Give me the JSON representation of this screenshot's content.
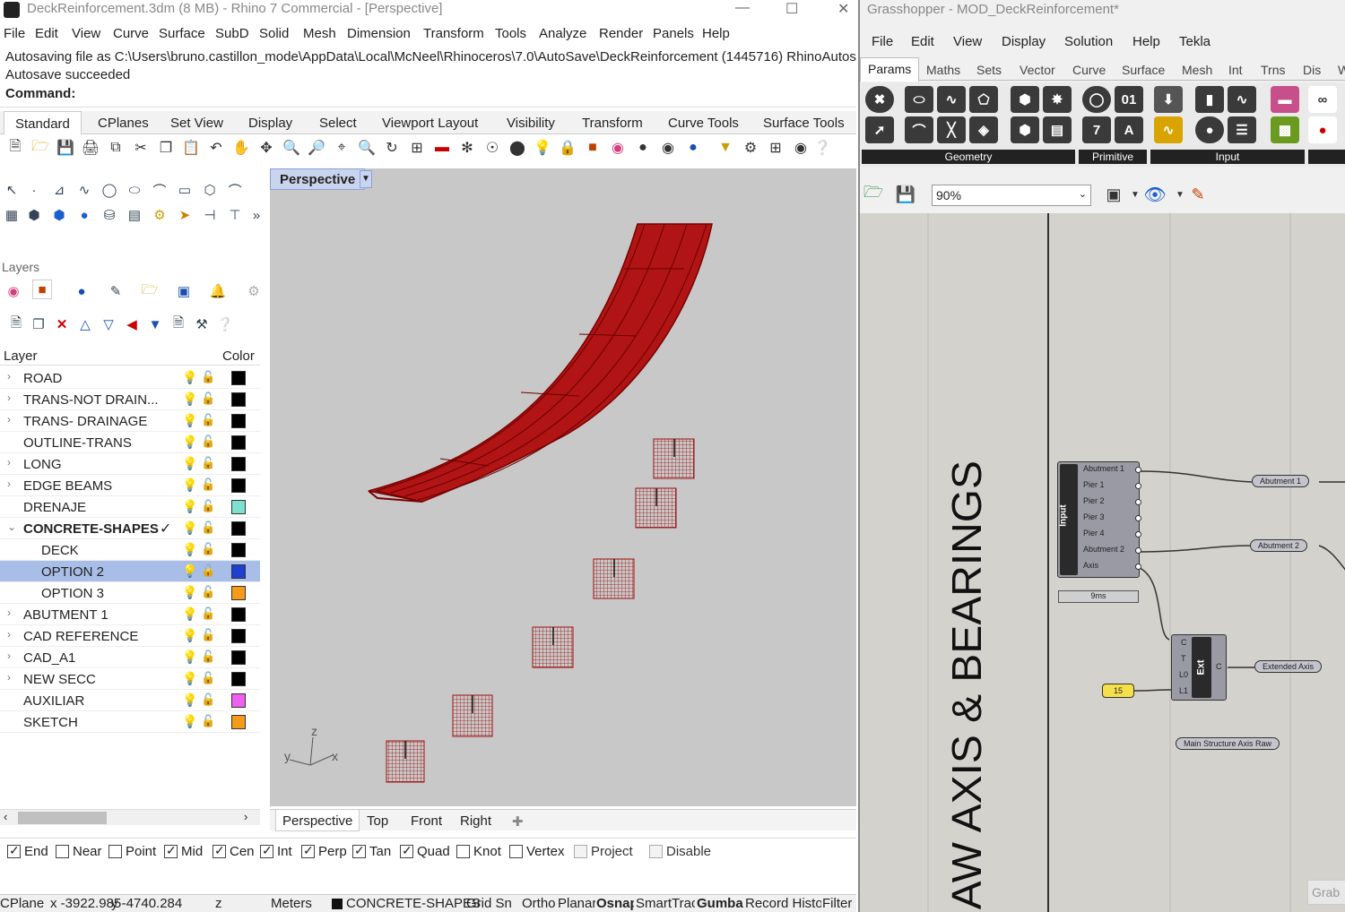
{
  "rhino": {
    "title": "DeckReinforcement.3dm (8 MB) - Rhino 7 Commercial - [Perspective]",
    "menu": [
      "File",
      "Edit",
      "View",
      "Curve",
      "Surface",
      "SubD",
      "Solid",
      "Mesh",
      "Dimension",
      "Transform",
      "Tools",
      "Analyze",
      "Render",
      "Panels",
      "Help"
    ],
    "cmd_history": [
      "Autosaving file as C:\\Users\\bruno.castillon_mode\\AppData\\Local\\McNeel\\Rhinoceros\\7.0\\AutoSave\\DeckReinforcement (1445716) RhinoAutos",
      "Autosave succeeded"
    ],
    "command_label": "Command:",
    "toolbar_tabs": [
      "Standard",
      "CPlanes",
      "Set View",
      "Display",
      "Select",
      "Viewport Layout",
      "Visibility",
      "Transform",
      "Curve Tools",
      "Surface Tools"
    ],
    "layers_title": "Layers",
    "layer_header": {
      "name": "Layer",
      "color": "Color"
    },
    "layers": [
      {
        "name": "ROAD",
        "expand": true,
        "indent": 0,
        "color": "#000000",
        "bold": false,
        "selected": false,
        "current": false
      },
      {
        "name": "TRANS-NOT DRAIN...",
        "expand": true,
        "indent": 0,
        "color": "#000000",
        "bold": false,
        "selected": false,
        "current": false
      },
      {
        "name": "TRANS- DRAINAGE",
        "expand": true,
        "indent": 0,
        "color": "#000000",
        "bold": false,
        "selected": false,
        "current": false
      },
      {
        "name": "OUTLINE-TRANS",
        "expand": false,
        "indent": 0,
        "color": "#000000",
        "bold": false,
        "selected": false,
        "current": false
      },
      {
        "name": "LONG",
        "expand": true,
        "indent": 0,
        "color": "#000000",
        "bold": false,
        "selected": false,
        "current": false
      },
      {
        "name": "EDGE BEAMS",
        "expand": true,
        "indent": 0,
        "color": "#000000",
        "bold": false,
        "selected": false,
        "current": false
      },
      {
        "name": "DRENAJE",
        "expand": false,
        "indent": 0,
        "color": "#7ee0d0",
        "bold": false,
        "selected": false,
        "current": false
      },
      {
        "name": "CONCRETE-SHAPES",
        "expand": true,
        "indent": 0,
        "color": "#000000",
        "bold": true,
        "selected": false,
        "current": true,
        "open": true
      },
      {
        "name": "DECK",
        "expand": false,
        "indent": 1,
        "color": "#000000",
        "bold": false,
        "selected": false,
        "current": false
      },
      {
        "name": "OPTION 2",
        "expand": false,
        "indent": 1,
        "color": "#1f3fd0",
        "bold": false,
        "selected": true,
        "current": false
      },
      {
        "name": "OPTION 3",
        "expand": false,
        "indent": 1,
        "color": "#f59a1a",
        "bold": false,
        "selected": false,
        "current": false
      },
      {
        "name": "ABUTMENT 1",
        "expand": true,
        "indent": 0,
        "color": "#000000",
        "bold": false,
        "selected": false,
        "current": false
      },
      {
        "name": "CAD REFERENCE",
        "expand": true,
        "indent": 0,
        "color": "#000000",
        "bold": false,
        "selected": false,
        "current": false
      },
      {
        "name": "CAD_A1",
        "expand": true,
        "indent": 0,
        "color": "#000000",
        "bold": false,
        "selected": false,
        "current": false
      },
      {
        "name": "NEW SECC",
        "expand": true,
        "indent": 0,
        "color": "#000000",
        "bold": false,
        "selected": false,
        "current": false
      },
      {
        "name": "AUXILIAR",
        "expand": false,
        "indent": 0,
        "color": "#f060f0",
        "bold": false,
        "selected": false,
        "current": false
      },
      {
        "name": "SKETCH",
        "expand": false,
        "indent": 0,
        "color": "#f59a1a",
        "bold": false,
        "selected": false,
        "current": false
      }
    ],
    "viewport": {
      "name": "Perspective",
      "axes": {
        "x": "x",
        "y": "y",
        "z": "z"
      }
    },
    "view_tabs": [
      "Perspective",
      "Top",
      "Front",
      "Right"
    ],
    "osnaps": [
      {
        "label": "End",
        "checked": true,
        "disabled": false
      },
      {
        "label": "Near",
        "checked": false,
        "disabled": false
      },
      {
        "label": "Point",
        "checked": false,
        "disabled": false
      },
      {
        "label": "Mid",
        "checked": true,
        "disabled": false
      },
      {
        "label": "Cen",
        "checked": true,
        "disabled": false
      },
      {
        "label": "Int",
        "checked": true,
        "disabled": false
      },
      {
        "label": "Perp",
        "checked": true,
        "disabled": false
      },
      {
        "label": "Tan",
        "checked": true,
        "disabled": false
      },
      {
        "label": "Quad",
        "checked": true,
        "disabled": false
      },
      {
        "label": "Knot",
        "checked": false,
        "disabled": false
      },
      {
        "label": "Vertex",
        "checked": false,
        "disabled": false
      },
      {
        "label": "Project",
        "checked": false,
        "disabled": true
      },
      {
        "label": "Disable",
        "checked": false,
        "disabled": true
      }
    ],
    "status": {
      "cplane": "CPlane",
      "x": "x -3922.985",
      "y": "y -4740.284",
      "z": "z",
      "units": "Meters",
      "layer": "CONCRETE-SHAPES",
      "toggles": [
        "Grid Snap",
        "Ortho",
        "Planar",
        "Osnap",
        "SmartTrack",
        "Gumball",
        "Record History",
        "Filter"
      ]
    }
  },
  "gh": {
    "title": "Grasshopper - MOD_DeckReinforcement*",
    "menu": [
      "File",
      "Edit",
      "View",
      "Display",
      "Solution",
      "Help",
      "Tekla"
    ],
    "tabs": [
      "Params",
      "Maths",
      "Sets",
      "Vector",
      "Curve",
      "Surface",
      "Mesh",
      "Int",
      "Trns",
      "Dis",
      "W"
    ],
    "groups": [
      "Geometry",
      "Primitive",
      "Input"
    ],
    "zoom": "90%",
    "group_title": "RAW AXIS & BEARINGS",
    "input_comp": {
      "label": "Input",
      "outputs": [
        "Abutment 1",
        "Pier 1",
        "Pier 2",
        "Pier 3",
        "Pier 4",
        "Abutment 2",
        "Axis"
      ],
      "time": "9ms"
    },
    "ext_comp": {
      "label": "Ext",
      "inputs": [
        "C",
        "T",
        "L0",
        "L1"
      ],
      "output": "C"
    },
    "slider_value": "15",
    "params": [
      "Abutment 1",
      "Abutment 2",
      "Extended Axis",
      "Main Structure Axis Raw"
    ],
    "grab": "Grab"
  }
}
